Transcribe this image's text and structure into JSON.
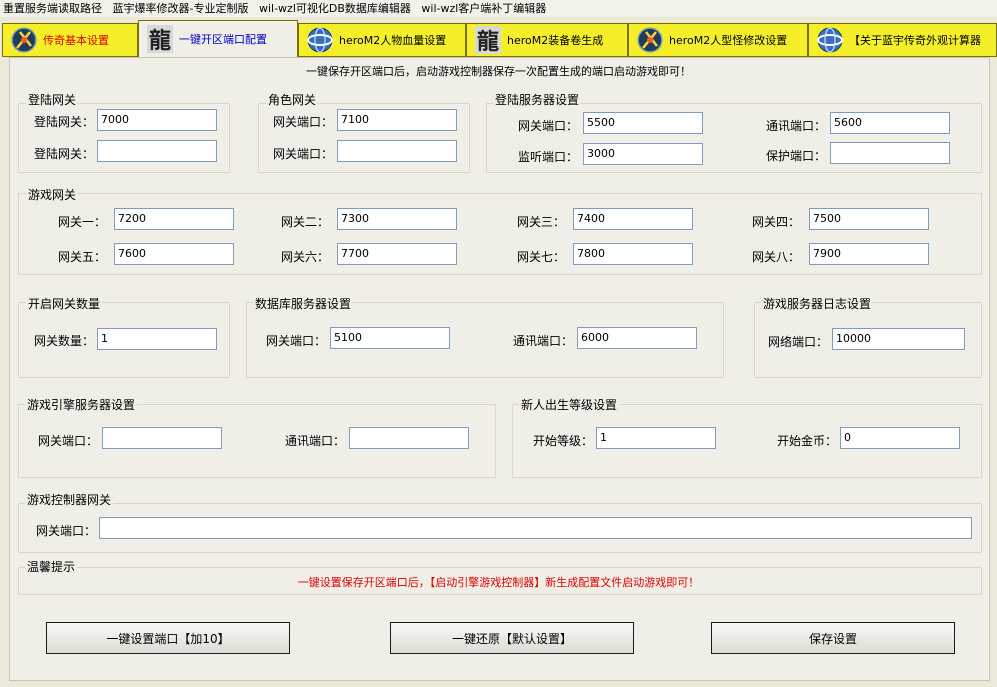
{
  "menu": [
    "重置服务端读取路径",
    "蓝宇爆率修改器-专业定制版",
    "wil-wzl可视化DB数据库编辑器",
    "wil-wzl客户端补丁编辑器"
  ],
  "tabs": [
    {
      "label": "传奇基本设置",
      "icon": "sword-emblem-icon"
    },
    {
      "label": "一键开区端口配置",
      "icon": "dragon-character-icon"
    },
    {
      "label": "heroM2人物血量设置",
      "icon": "globe-icon"
    },
    {
      "label": "heroM2装备卷生成",
      "icon": "dragon-character-icon"
    },
    {
      "label": "heroM2人型怪修改设置",
      "icon": "sword-emblem-icon"
    },
    {
      "label": "【关于蓝宇传奇外观计算器",
      "icon": "globe-icon"
    }
  ],
  "notice": "一键保存开区端口后，启动游戏控制器保存一次配置生成的端口启动游戏即可！",
  "login_gate": {
    "title": "登陆网关",
    "l1": "登陆网关：",
    "v1": "7000",
    "l2": "登陆网关：",
    "v2": ""
  },
  "role_gate": {
    "title": "角色网关",
    "l1": "网关端口：",
    "v1": "7100",
    "l2": "网关端口：",
    "v2": ""
  },
  "login_server": {
    "title": "登陆服务器设置",
    "l1": "网关端口：",
    "v1": "5500",
    "l2": "通讯端口：",
    "v2": "5600",
    "l3": "监听端口：",
    "v3": "3000",
    "l4": "保护端口：",
    "v4": ""
  },
  "game_gate": {
    "title": "游戏网关",
    "items": [
      {
        "label": "网关一：",
        "value": "7200"
      },
      {
        "label": "网关二：",
        "value": "7300"
      },
      {
        "label": "网关三：",
        "value": "7400"
      },
      {
        "label": "网关四：",
        "value": "7500"
      },
      {
        "label": "网关五：",
        "value": "7600"
      },
      {
        "label": "网关六：",
        "value": "7700"
      },
      {
        "label": "网关七：",
        "value": "7800"
      },
      {
        "label": "网关八：",
        "value": "7900"
      }
    ]
  },
  "gate_count": {
    "title": "开启网关数量",
    "label": "网关数量：",
    "value": "1"
  },
  "db_server": {
    "title": "数据库服务器设置",
    "l1": "网关端口：",
    "v1": "5100",
    "l2": "通讯端口：",
    "v2": "6000"
  },
  "log_server": {
    "title": "游戏服务器日志设置",
    "label": "网络端口：",
    "value": "10000"
  },
  "engine_server": {
    "title": "游戏引擎服务器设置",
    "l1": "网关端口：",
    "v1": "",
    "l2": "通讯端口：",
    "v2": ""
  },
  "newbie": {
    "title": "新人出生等级设置",
    "l1": "开始等级：",
    "v1": "1",
    "l2": "开始金币：",
    "v2": "0"
  },
  "controller_gate": {
    "title": "游戏控制器网关",
    "label": "网关端口：",
    "value": ""
  },
  "tips": {
    "title": "温馨提示",
    "text": "一键设置保存开区端口后，【启动引擎游戏控制器】新生成配置文件启动游戏即可！"
  },
  "buttons": {
    "auto_port": "一键设置端口【加10】",
    "restore": "一键还原【默认设置】",
    "save": "保存设置"
  }
}
